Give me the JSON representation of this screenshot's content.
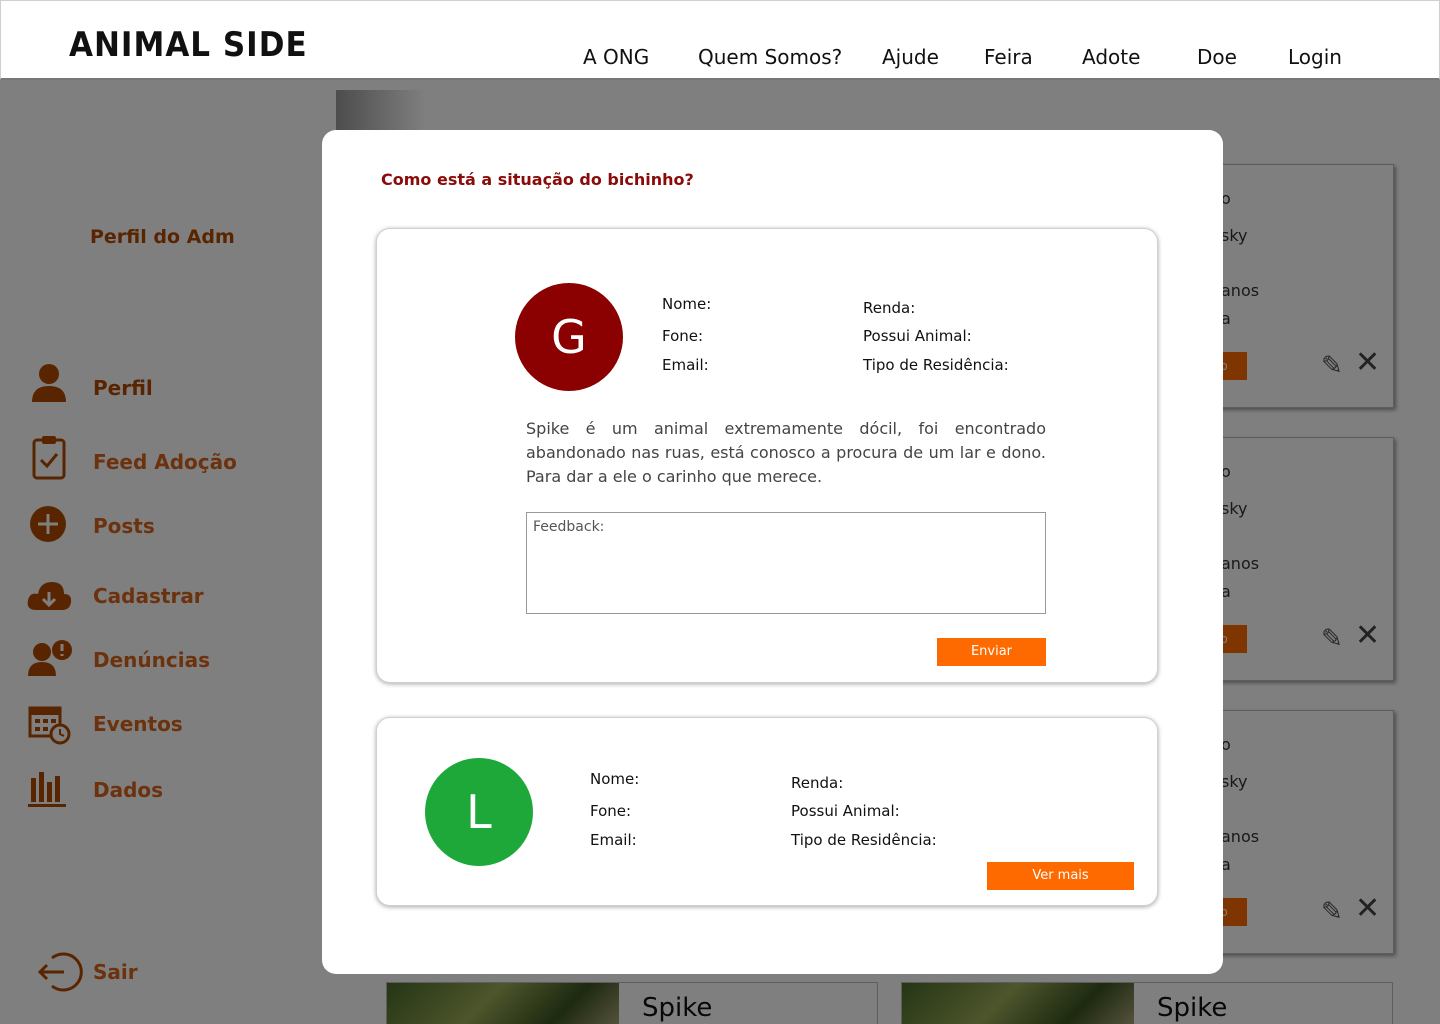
{
  "header": {
    "logo": "ANIMAL SIDE",
    "nav": [
      "A ONG",
      "Quem Somos?",
      "Ajude",
      "Feira",
      "Adote",
      "Doe",
      "Login"
    ]
  },
  "sidebar": {
    "title": "Perfil do Adm",
    "items": [
      {
        "label": "Perfil",
        "icon": "user-icon"
      },
      {
        "label": "Feed Adoção",
        "icon": "clipboard-check-icon"
      },
      {
        "label": "Posts",
        "icon": "plus-circle-icon"
      },
      {
        "label": "Cadastrar",
        "icon": "cloud-download-icon"
      },
      {
        "label": "Denúncias",
        "icon": "user-alert-icon"
      },
      {
        "label": "Eventos",
        "icon": "calendar-clock-icon"
      },
      {
        "label": "Dados",
        "icon": "bar-chart-icon"
      }
    ],
    "logout": {
      "label": "Sair",
      "icon": "logout-icon"
    }
  },
  "background": {
    "cards": [
      {
        "line1": "o",
        "line2": "sky",
        "line3": "anos",
        "line4": "a",
        "button": "o"
      },
      {
        "line1": "o",
        "line2": "sky",
        "line3": "anos",
        "line4": "a",
        "button": "o"
      },
      {
        "line1": "o",
        "line2": "sky",
        "line3": "anos",
        "line4": "a",
        "button": "o"
      }
    ],
    "bottom_cards": [
      {
        "name": "Spike"
      },
      {
        "name": "Spike"
      }
    ]
  },
  "modal": {
    "title": "Como está  a situação do bichinho?",
    "applications": [
      {
        "initial": "G",
        "avatar_color": "#8b0000",
        "nome": "Nome:",
        "fone": "Fone:",
        "email": "Email:",
        "renda": "Renda:",
        "possui_animal": "Possui Animal:",
        "tipo_residencia": "Tipo de Residência:",
        "description": "Spike é um animal extremamente dócil, foi encontrado abandonado nas ruas, está conosco a procura de um lar e dono. Para dar a ele o carinho que merece.",
        "feedback_placeholder": "Feedback:",
        "button": "Enviar"
      },
      {
        "initial": "L",
        "avatar_color": "#1ea83a",
        "nome": "Nome:",
        "fone": "Fone:",
        "email": "Email:",
        "renda": "Renda:",
        "possui_animal": "Possui Animal:",
        "tipo_residencia": "Tipo de Residência:",
        "button": "Ver mais"
      }
    ]
  },
  "colors": {
    "accent": "#ff6a00",
    "sidebar_text": "#d9621b",
    "title_red": "#8b0a0a"
  }
}
